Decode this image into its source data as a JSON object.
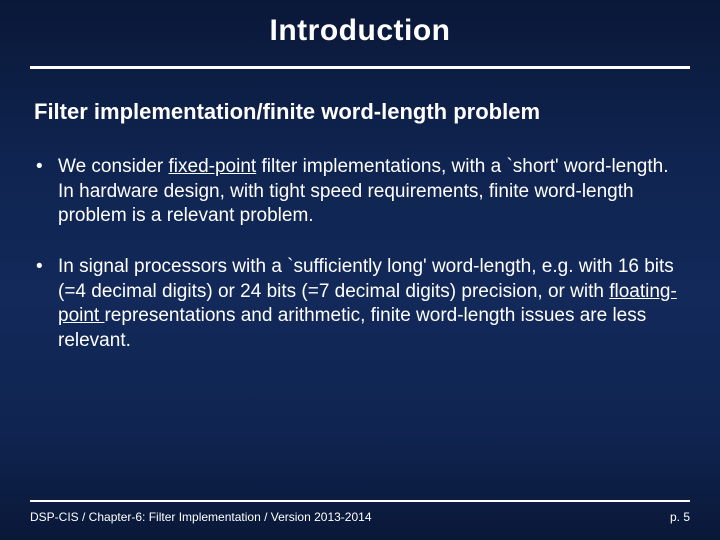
{
  "title": "Introduction",
  "subtitle": "Filter implementation/finite word-length problem",
  "bullet1": {
    "pre": "We consider ",
    "u1": "fixed-point",
    "post": " filter implementations, with a `short' word-length.",
    "line2": "In hardware design, with tight speed requirements, finite word-length problem is a relevant problem."
  },
  "bullet2": {
    "pre": "In signal processors with a `sufficiently long' word-length, e.g. with 16 bits (=4 decimal digits) or 24 bits (=7 decimal digits) precision, or with ",
    "u1": "floating-point ",
    "post": "representations and arithmetic, finite word-length issues are less relevant."
  },
  "footer": {
    "left": "DSP-CIS / Chapter-6: Filter Implementation / Version 2013-2014",
    "right": "p. 5"
  }
}
